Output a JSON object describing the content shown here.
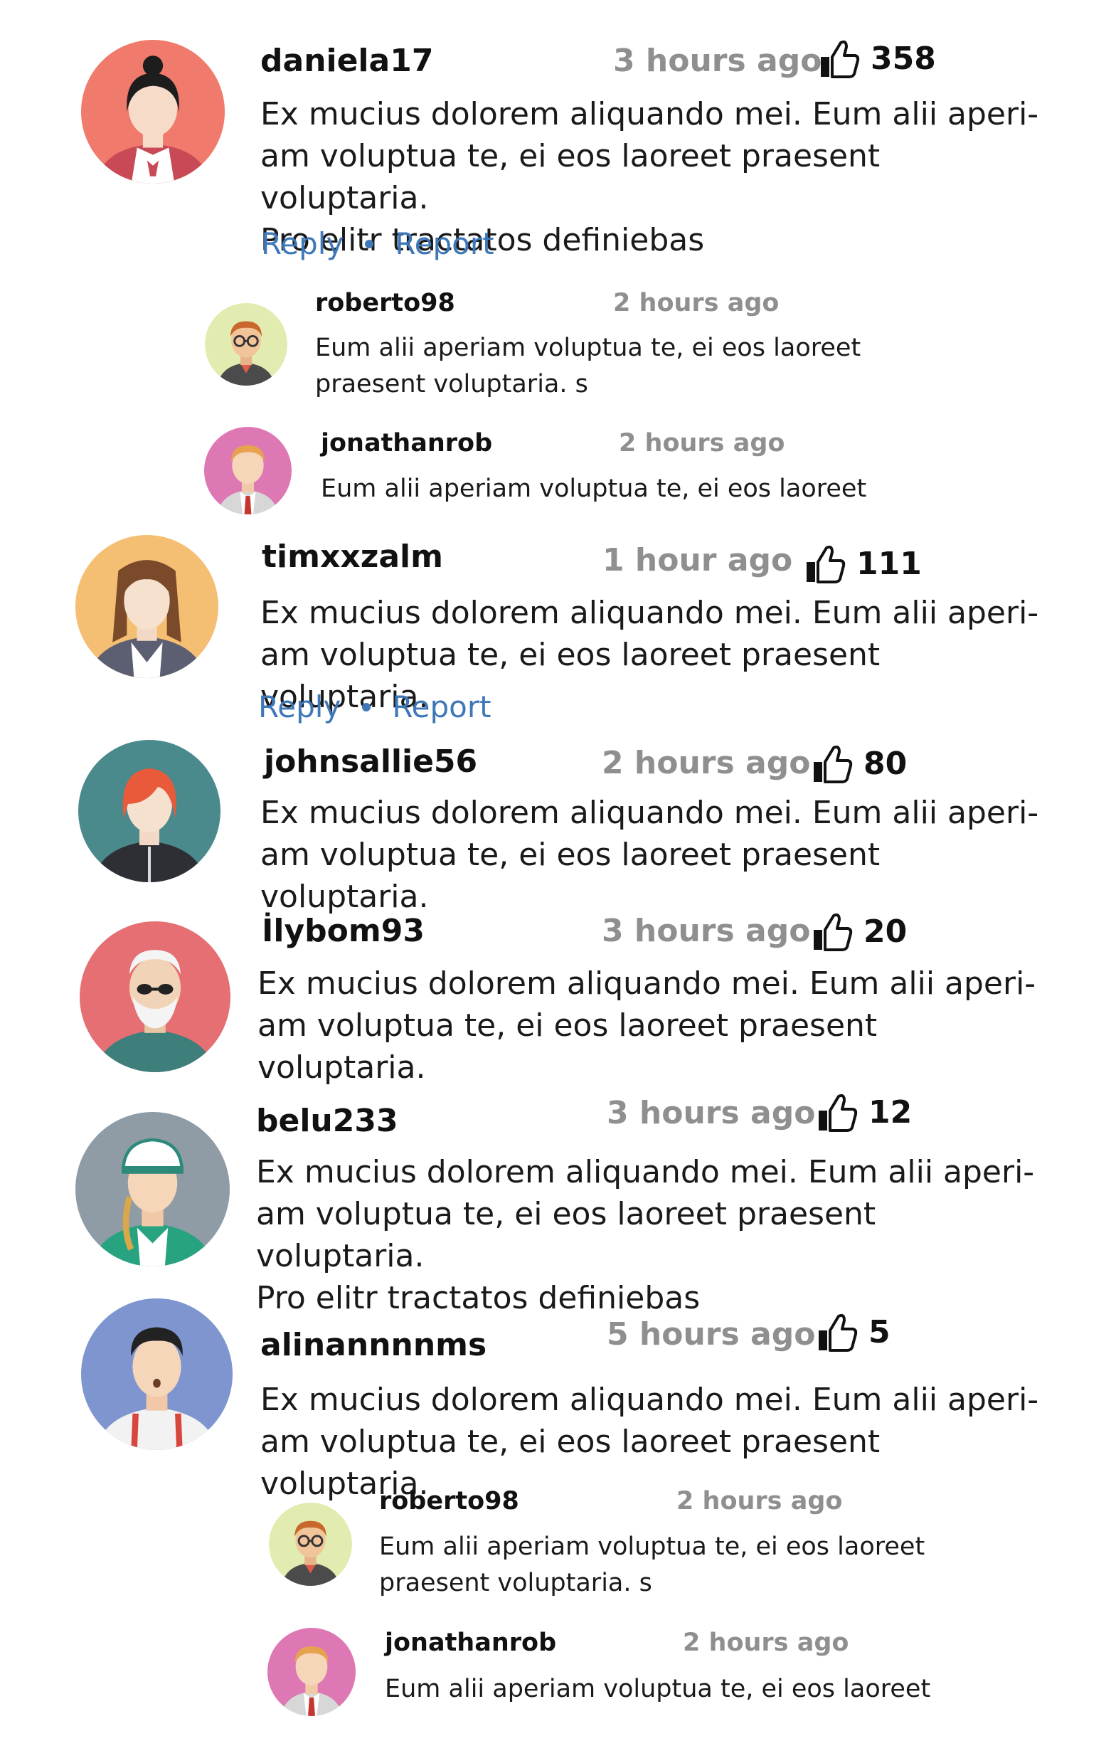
{
  "thread": {
    "comments": [
      {
        "user": "daniela17",
        "time": "3 hours ago",
        "likes": "358",
        "lines": [
          "Ex mucius dolorem aliquando mei. Eum alii aperi-",
          "am voluptua te, ei eos laoreet praesent voluptaria.",
          "Pro elitr tractatos definiebas"
        ],
        "reply_label": "Reply",
        "report_label": "Report"
      },
      {
        "user": "roberto98",
        "time": "2 hours ago",
        "lines": [
          "Eum alii aperiam voluptua te, ei eos laoreet",
          "praesent voluptaria. s"
        ]
      },
      {
        "user": "jonathanrob",
        "time": "2 hours ago",
        "lines": [
          "Eum alii aperiam voluptua te, ei eos laoreet"
        ]
      },
      {
        "user": "timxxzalm",
        "time": "1 hour ago",
        "likes": "111",
        "lines": [
          "Ex mucius dolorem aliquando mei. Eum alii aperi-",
          "am voluptua te, ei eos laoreet praesent voluptaria."
        ],
        "reply_label": "Reply",
        "report_label": "Report"
      },
      {
        "user": "johnsallie56",
        "time": "2 hours ago",
        "likes": "80",
        "lines": [
          "Ex mucius dolorem aliquando mei. Eum alii aperi-",
          "am voluptua te, ei eos laoreet praesent voluptaria."
        ]
      },
      {
        "user": "İlybom93",
        "time": "3 hours ago",
        "likes": "20",
        "lines": [
          "Ex mucius dolorem aliquando mei. Eum alii aperi-",
          "am voluptua te, ei eos laoreet praesent voluptaria."
        ]
      },
      {
        "user": "belu233",
        "time": "3 hours ago",
        "likes": "12",
        "lines": [
          "Ex mucius dolorem aliquando mei. Eum alii aperi-",
          "am voluptua te, ei eos laoreet praesent voluptaria.",
          "Pro elitr tractatos definiebas"
        ]
      },
      {
        "user": "alinannnnms",
        "time": "5 hours ago",
        "likes": "5",
        "lines": [
          "Ex mucius dolorem aliquando mei. Eum alii aperi-",
          "am voluptua te, ei eos laoreet praesent voluptaria."
        ]
      },
      {
        "user": "roberto98",
        "time": "2 hours ago",
        "lines": [
          "Eum alii aperiam voluptua te, ei eos laoreet",
          "praesent voluptaria. s"
        ]
      },
      {
        "user": "jonathanrob",
        "time": "2 hours ago",
        "lines": [
          "Eum alii aperiam voluptua te, ei eos laoreet"
        ]
      }
    ]
  },
  "icons": {
    "like": "thumbs-up-icon",
    "avatar": "user-avatar"
  },
  "colors": {
    "link": "#3f78b8",
    "timestamp": "#8f8f8f",
    "avatar_daniela": "#f07a6b",
    "avatar_roberto": "#e3ecb0",
    "avatar_jonathan": "#de78b4",
    "avatar_tim": "#f4bf72",
    "avatar_johnsallie": "#4a8a8c",
    "avatar_ily": "#e56f73",
    "avatar_belu": "#8f9ca6",
    "avatar_alina": "#7e95cf"
  }
}
